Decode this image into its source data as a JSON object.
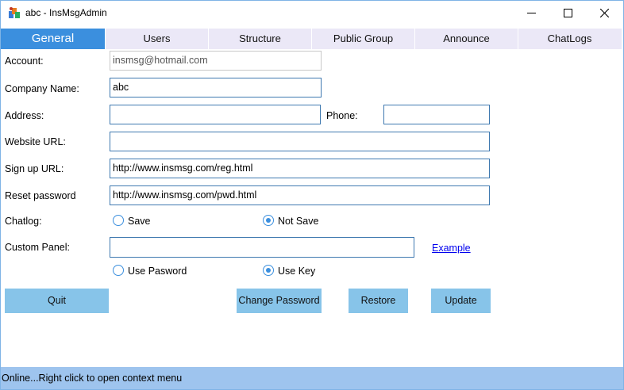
{
  "window": {
    "title": "abc - InsMsgAdmin"
  },
  "tabs": [
    {
      "label": "General",
      "active": true
    },
    {
      "label": "Users"
    },
    {
      "label": "Structure"
    },
    {
      "label": "Public Group"
    },
    {
      "label": "Announce"
    },
    {
      "label": "ChatLogs"
    }
  ],
  "form": {
    "account_label": "Account:",
    "account_value": "insmsg@hotmail.com",
    "company_label": "Company Name:",
    "company_value": "abc",
    "address_label": "Address:",
    "address_value": "",
    "phone_label": "Phone:",
    "phone_value": "",
    "website_label": "Website URL:",
    "website_value": "",
    "signup_label": "Sign up URL:",
    "signup_value": "http://www.insmsg.com/reg.html",
    "reset_label": "Reset password",
    "reset_value": "http://www.insmsg.com/pwd.html",
    "chatlog_label": "Chatlog:",
    "chatlog_options": [
      {
        "label": "Save",
        "selected": false
      },
      {
        "label": "Not Save",
        "selected": true
      }
    ],
    "custom_label": "Custom Panel:",
    "custom_value": "",
    "example_link": "Example",
    "auth_options": [
      {
        "label": "Use Pasword",
        "selected": false
      },
      {
        "label": "Use Key",
        "selected": true
      }
    ]
  },
  "buttons": {
    "quit": "Quit",
    "change_password": "Change Password",
    "restore": "Restore",
    "update": "Update"
  },
  "status": {
    "text": "Online...Right click to open context menu"
  },
  "colors": {
    "accent": "#3b8fde",
    "tab_bg": "#ebe8f7",
    "button_bg": "#87c4e9",
    "status_bg": "#9ec4ee"
  }
}
